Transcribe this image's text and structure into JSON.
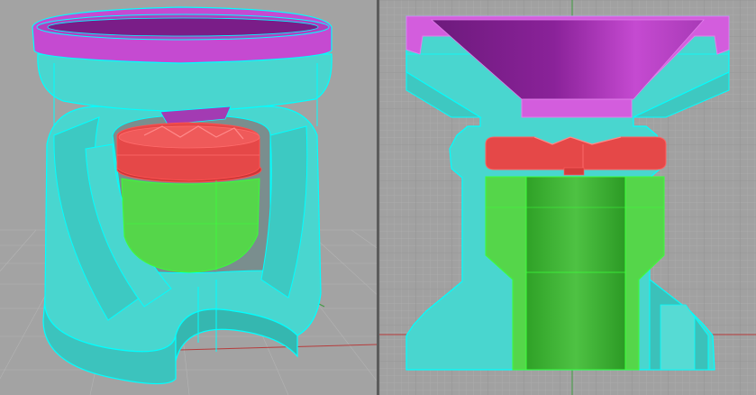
{
  "app": {
    "name": ""
  },
  "viewports": [
    {
      "id": "perspective",
      "label": "",
      "type": "3D perspective, shaded with wireframe edges"
    },
    {
      "id": "front",
      "label": "",
      "type": "orthographic section view"
    }
  ],
  "colors": {
    "background": "#a3a3a3",
    "grid_minor": "#b0b0b0",
    "grid_major": "#8e8e8e",
    "axis_x": "#b63c3c",
    "axis_y": "#3f9a3f",
    "edge": "#00d8d8",
    "cyan_body": "#49d6cf",
    "cyan_body_dark": "#2fb3ac",
    "magenta_cup": "#c54ad1",
    "magenta_cup_dark": "#8a1f9a",
    "red_nut": "#e54848",
    "green_core": "#55d64a",
    "green_core_dark": "#2fa127"
  },
  "objects": [
    {
      "name": "housing",
      "color": "cyan"
    },
    {
      "name": "funnel-cup",
      "color": "magenta"
    },
    {
      "name": "wing-nut",
      "color": "red"
    },
    {
      "name": "core-cylinder",
      "color": "green"
    }
  ]
}
